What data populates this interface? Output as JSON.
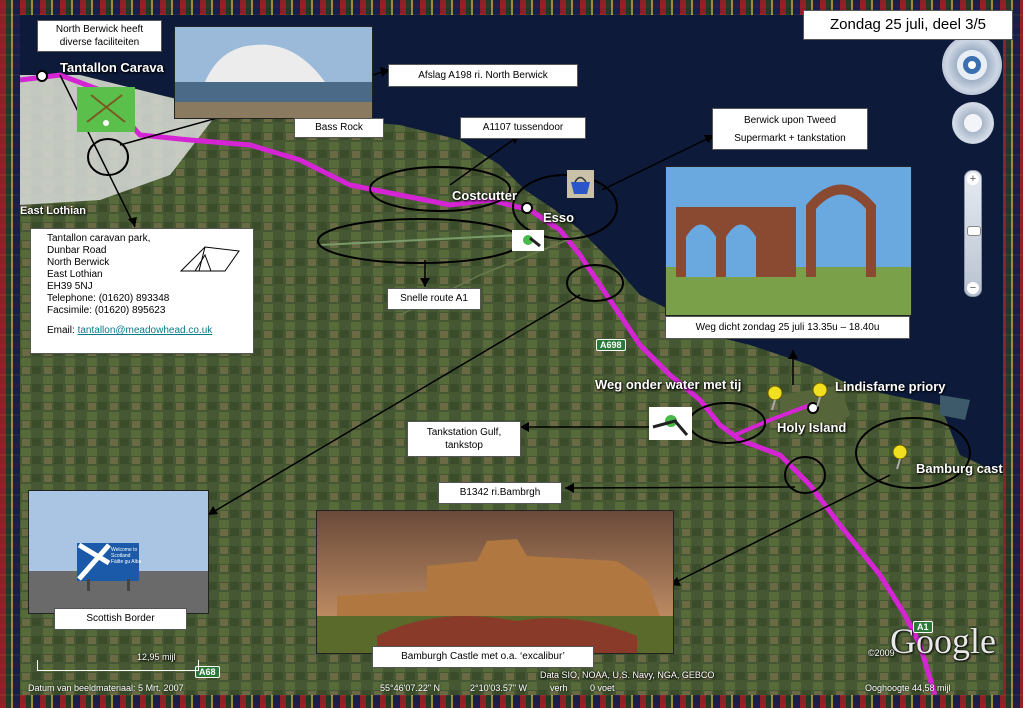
{
  "title": "Zondag 25 juli, deel 3/5",
  "map_labels": {
    "tantallon": "Tantallon Carava",
    "east_lothian": "East Lothian",
    "costcutter": "Costcutter",
    "esso": "Esso",
    "weg_onder_water": "Weg onder water met tij",
    "lindisfarne": "Lindisfarne priory",
    "holy_island": "Holy Island",
    "bamburg": "Bamburg cast"
  },
  "road_shields": {
    "a698": "A698",
    "a1": "A1",
    "a68": "A68"
  },
  "callouts": {
    "north_berwick": "North Berwick heeft diverse faciliteiten",
    "afslag": "Afslag A198 ri. North Berwick",
    "bass_rock": "Bass Rock",
    "a1107": "A1107 tussendoor",
    "berwick_line1": "Berwick upon Tweed",
    "berwick_line2": "Supermarkt + tankstation",
    "snelle_route": "Snelle route A1",
    "weg_dicht": "Weg dicht zondag 25 juli 13.35u – 18.40u",
    "gulf": "Tankstation Gulf, tankstop",
    "b1342": "B1342 ri.Bambrgh",
    "scottish_border": "Scottish Border",
    "bamburgh_castle": "Bamburgh Castle met o.a. ‘excalibur’"
  },
  "caravan_park": {
    "lines": [
      "Tantallon caravan park,",
      "Dunbar Road",
      "North Berwick",
      "East Lothian",
      "EH39 5NJ",
      "Telephone: (01620) 893348",
      "Facsimile: (01620) 895623"
    ],
    "email_label": "Email:",
    "email": "tantallon@meadowhead.co.uk"
  },
  "sign_text": {
    "line1": "Welcome to",
    "line2": "Scotland",
    "line3": "Fàilte gu Alba"
  },
  "status": {
    "scale": "12,95 mijl",
    "date": "Datum van beeldmateriaal:  5 Mrt. 2007",
    "lat": "55°46'07.22\" N",
    "lon": "2°10'03.57\" W",
    "verh": "verh",
    "voet": "0 voet",
    "credits": "Data SIO, NOAA, U.S. Navy, NGA, GEBCO",
    "year": "©2009",
    "altitude": "Ooghoogte   44,58 mijl",
    "google": "Google"
  },
  "colors": {
    "route": "#d424d4",
    "water": "#0d1a3a",
    "callout_bg": "#ffffff"
  },
  "icons": [
    "golf-icon",
    "tent-icon",
    "shopping-basket-icon",
    "fuel-nozzle-icon",
    "pushpin-icon",
    "compass-icon",
    "zoom-slider"
  ]
}
